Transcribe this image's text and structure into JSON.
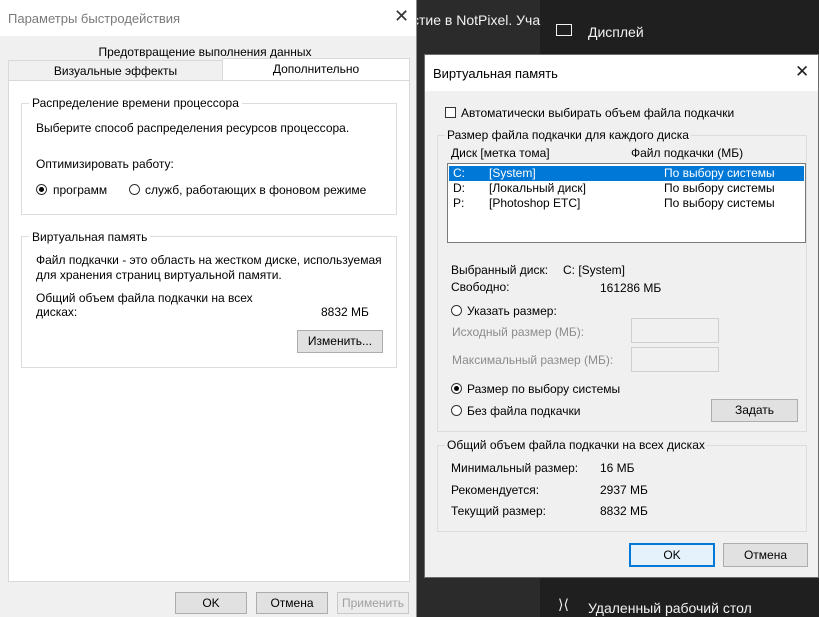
{
  "background": {
    "browser_text": "стие в NotPixel. Уча",
    "settings_display": "Дисплей",
    "settings_remote": "Удаленный рабочий стол"
  },
  "perf": {
    "title": "Параметры быстродействия",
    "tabs": {
      "dep": "Предотвращение выполнения данных",
      "visual": "Визуальные эффекты",
      "advanced": "Дополнительно"
    },
    "cpu": {
      "title": "Распределение времени процессора",
      "desc": "Выберите способ распределения ресурсов процессора.",
      "optimize_label": "Оптимизировать работу:",
      "opt_programs": "программ",
      "opt_services": "служб, работающих в фоновом режиме"
    },
    "vm": {
      "title": "Виртуальная память",
      "desc": "Файл подкачки - это область на жестком диске, используемая для хранения страниц виртуальной памяти.",
      "total_label": "Общий объем файла подкачки на всех дисках:",
      "total_value": "8832 МБ",
      "change_button": "Изменить..."
    },
    "buttons": {
      "ok": "OK",
      "cancel": "Отмена",
      "apply": "Применить"
    }
  },
  "vmdialog": {
    "title": "Виртуальная память",
    "auto_label": "Автоматически выбирать объем файла подкачки",
    "per_disk_title": "Размер файла подкачки для каждого диска",
    "col_disk": "Диск [метка тома]",
    "col_size": "Файл подкачки (МБ)",
    "drives": [
      {
        "letter": "C:",
        "label": "[System]",
        "size": "По выбору системы"
      },
      {
        "letter": "D:",
        "label": "[Локальный диск]",
        "size": "По выбору системы"
      },
      {
        "letter": "P:",
        "label": "[Photoshop ETC]",
        "size": "По выбору системы"
      }
    ],
    "selected_disk_label": "Выбранный диск:",
    "selected_disk_value": "C:  [System]",
    "free_label": "Свободно:",
    "free_value": "161286 МБ",
    "custom_size": "Указать размер:",
    "initial_size": "Исходный размер (МБ):",
    "max_size": "Максимальный размер (МБ):",
    "system_managed": "Размер по выбору системы",
    "no_paging": "Без файла подкачки",
    "set_button": "Задать",
    "totals_title": "Общий объем файла подкачки на всех дисках",
    "min_label": "Минимальный размер:",
    "min_value": "16 МБ",
    "rec_label": "Рекомендуется:",
    "rec_value": "2937 МБ",
    "cur_label": "Текущий размер:",
    "cur_value": "8832 МБ",
    "ok": "OK",
    "cancel": "Отмена"
  }
}
